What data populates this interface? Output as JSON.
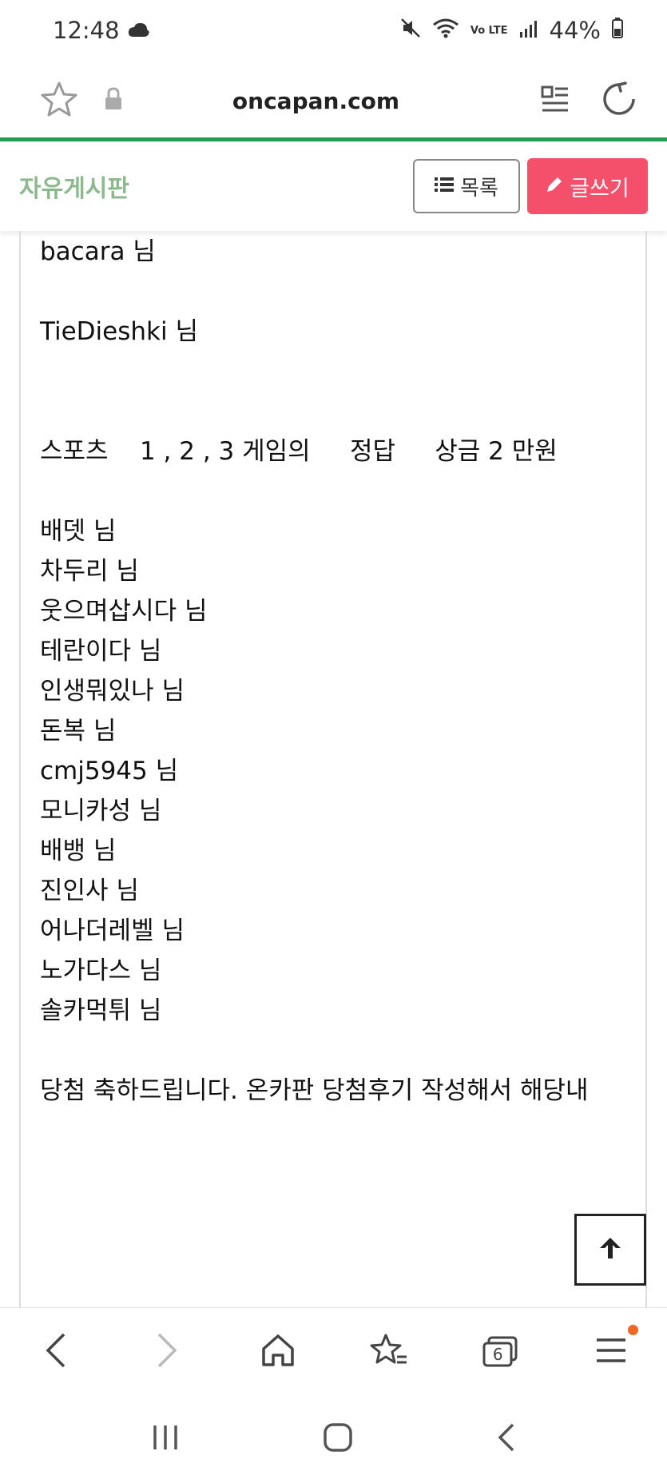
{
  "status_bar": {
    "time": "12:48",
    "network": "Vo LTE",
    "battery": "44%"
  },
  "browser": {
    "url": "oncapan.com"
  },
  "board": {
    "title": "자유게시판",
    "list_label": "목록",
    "write_label": "글쓰기"
  },
  "content": {
    "lines": [
      "bacara 님",
      "TieDieshki 님",
      "스포츠    1 , 2 , 3 게임의     정답     상금 2 만원",
      "배뎃 님",
      "차두리 님",
      "웃으며삽시다 님",
      "테란이다 님",
      "인생뭐있나 님",
      "돈복 님",
      "cmj5945 님",
      "모니카성 님",
      "배뱅 님",
      "진인사 님",
      "어나더레벨 님",
      "노가다스 님",
      "솔카먹튀 님",
      "당첨 축하드립니다. 온카판 당첨후기 작성해서 해당내"
    ]
  },
  "bottom_nav": {
    "tab_count": "6"
  },
  "colors": {
    "accent_green": "#1f9d55",
    "board_title": "#8dba8d",
    "write_button": "#f5506b",
    "notification_dot": "#f26522"
  }
}
